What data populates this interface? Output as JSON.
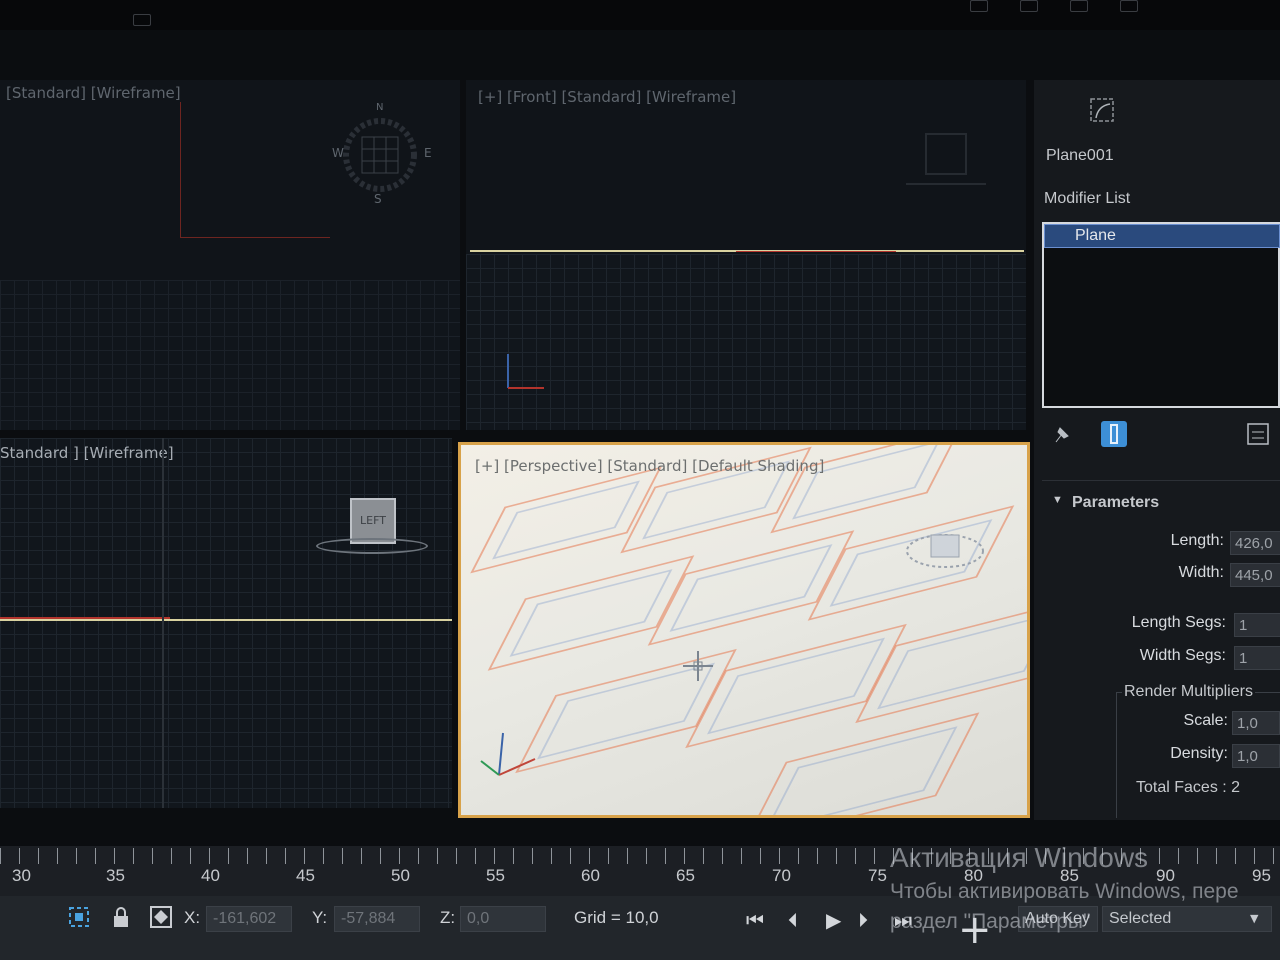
{
  "viewports": {
    "top_label": "[Standard] [Wireframe]",
    "front_label": "[+] [Front] [Standard] [Wireframe]",
    "left_label": "Standard ] [Wireframe]",
    "perspective_label": "[+] [Perspective] [Standard] [Default Shading]",
    "viewcube_left_text": "LEFT",
    "compass_n": "N",
    "compass_s": "S",
    "compass_e": "E",
    "compass_w": "W"
  },
  "command_panel": {
    "object_name": "Plane001",
    "modifier_list_label": "Modifier List",
    "modifier_stack": [
      "Plane"
    ],
    "rollout_title": "Parameters",
    "params": [
      {
        "label": "Length:",
        "value": "426,0"
      },
      {
        "label": "Width:",
        "value": "445,0"
      },
      {
        "label": "Length Segs:",
        "value": "1"
      },
      {
        "label": "Width Segs:",
        "value": "1"
      }
    ],
    "render_multipliers_label": "Render Multipliers",
    "multipliers": [
      {
        "label": "Scale:",
        "value": "1,0"
      },
      {
        "label": "Density:",
        "value": "1,0"
      }
    ],
    "total_faces": "Total Faces : 2"
  },
  "timeline": {
    "ticks": [
      "30",
      "35",
      "40",
      "45",
      "50",
      "55",
      "60",
      "65",
      "70",
      "75",
      "80",
      "85",
      "90",
      "95"
    ]
  },
  "status_bar": {
    "x_label": "X:",
    "x_value": "-161,602",
    "y_label": "Y:",
    "y_value": "-57,884",
    "z_label": "Z:",
    "z_value": "0,0",
    "grid_text": "Grid = 10,0",
    "auto_key_label": "Auto Key",
    "selected_label": "Selected"
  },
  "watermark": {
    "line1": "Активация Windows",
    "line2": "Чтобы активировать Windows, пере",
    "line3": "раздел \"Параметры\""
  },
  "colors": {
    "accent_orange": "#d8a24a",
    "selection_blue": "#2a4a7d",
    "axis_red": "#b3342c",
    "axis_yellow": "#d9d2a0"
  }
}
